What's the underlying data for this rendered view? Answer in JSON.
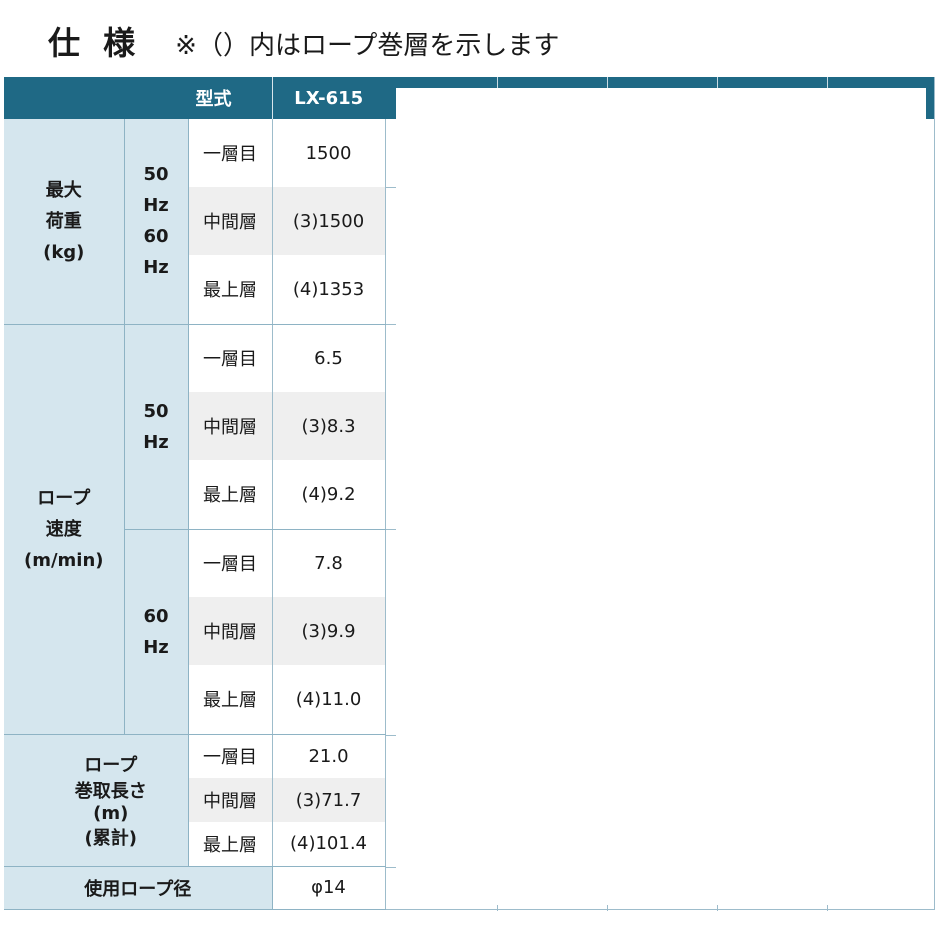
{
  "heading": {
    "title": "仕 様",
    "note": "※（）内はロープ巻層を示します"
  },
  "table": {
    "header_label": "型式",
    "model": "LX-615",
    "load": {
      "category": [
        "最大",
        "荷重",
        "(kg)"
      ],
      "freq": [
        "50",
        "Hz",
        "60",
        "Hz"
      ],
      "rows": [
        {
          "layer": "一層目",
          "value": "1500"
        },
        {
          "layer": "中間層",
          "value": "(3)1500"
        },
        {
          "layer": "最上層",
          "value": "(4)1353"
        }
      ]
    },
    "speed": {
      "category": [
        "ロープ",
        "速度",
        "(m/min)"
      ],
      "groups": [
        {
          "freq": [
            "50",
            "Hz"
          ],
          "rows": [
            {
              "layer": "一層目",
              "value": "6.5"
            },
            {
              "layer": "中間層",
              "value": "(3)8.3"
            },
            {
              "layer": "最上層",
              "value": "(4)9.2"
            }
          ]
        },
        {
          "freq": [
            "60",
            "Hz"
          ],
          "rows": [
            {
              "layer": "一層目",
              "value": "7.8"
            },
            {
              "layer": "中間層",
              "value": "(3)9.9"
            },
            {
              "layer": "最上層",
              "value": "(4)11.0"
            }
          ]
        }
      ]
    },
    "length": {
      "category": [
        "ロープ",
        "巻取長さ",
        "(m)",
        "(累計)"
      ],
      "rows": [
        {
          "layer": "一層目",
          "value": "21.0"
        },
        {
          "layer": "中間層",
          "value": "(3)71.7"
        },
        {
          "layer": "最上層",
          "value": "(4)101.4"
        }
      ]
    },
    "diameter": {
      "label": "使用ロープ径",
      "value": "φ14"
    }
  }
}
